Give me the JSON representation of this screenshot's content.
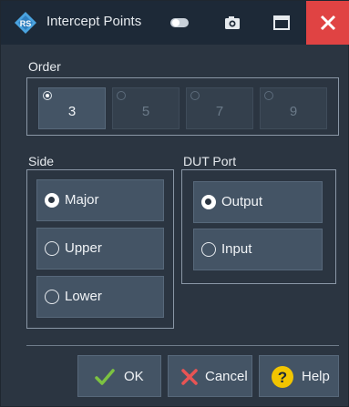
{
  "window": {
    "title": "Intercept Points",
    "app_icon": "rs-logo-icon",
    "title_buttons": [
      "toggle-icon",
      "camera-icon",
      "maximize-icon",
      "close-icon"
    ],
    "colors": {
      "background": "#2b3541",
      "titlebar": "#1d2937",
      "close": "#e04343",
      "button": "#445465"
    }
  },
  "order": {
    "label": "Order",
    "options": [
      {
        "value": "3",
        "selected": true,
        "enabled": true
      },
      {
        "value": "5",
        "selected": false,
        "enabled": false
      },
      {
        "value": "7",
        "selected": false,
        "enabled": false
      },
      {
        "value": "9",
        "selected": false,
        "enabled": false
      }
    ]
  },
  "side": {
    "label": "Side",
    "options": [
      {
        "label": "Major",
        "selected": true
      },
      {
        "label": "Upper",
        "selected": false
      },
      {
        "label": "Lower",
        "selected": false
      }
    ]
  },
  "dut_port": {
    "label": "DUT Port",
    "options": [
      {
        "label": "Output",
        "selected": true
      },
      {
        "label": "Input",
        "selected": false
      }
    ]
  },
  "buttons": {
    "ok": {
      "label": "OK",
      "icon": "checkmark-icon"
    },
    "cancel": {
      "label": "Cancel",
      "icon": "x-icon"
    },
    "help": {
      "label": "Help",
      "icon": "question-icon"
    }
  }
}
